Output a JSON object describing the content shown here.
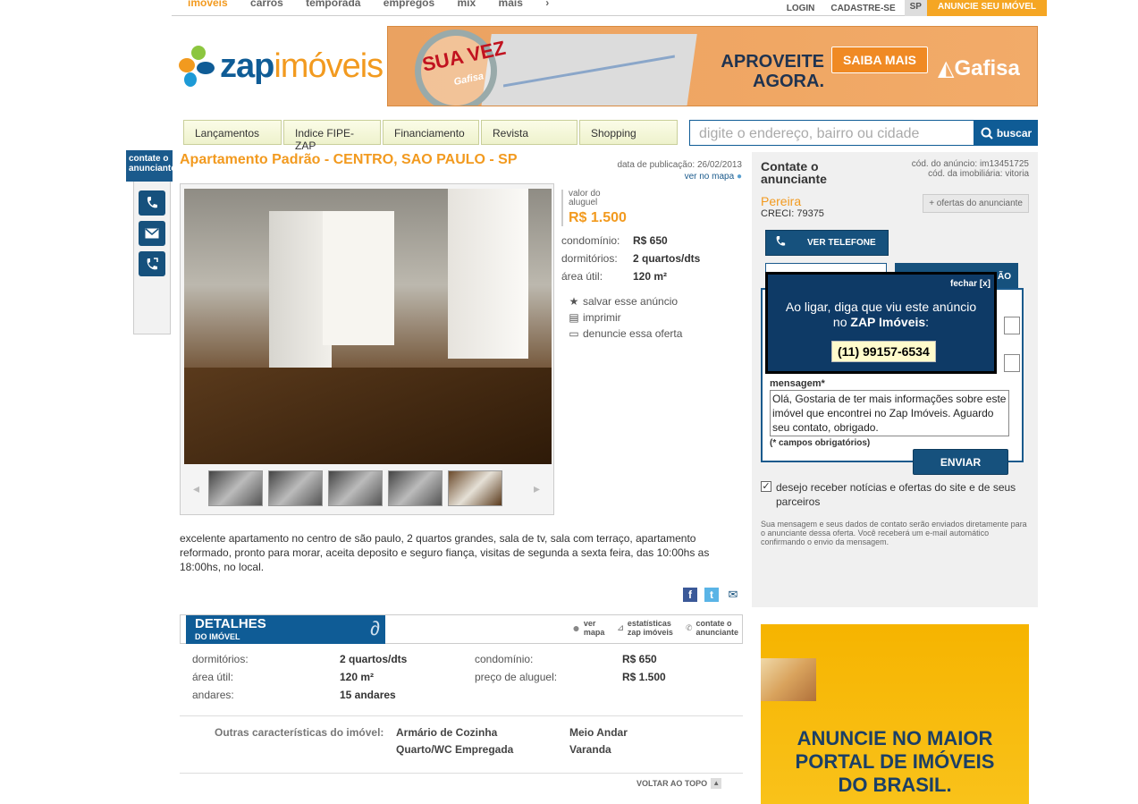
{
  "topnav": {
    "links": [
      "imóveis",
      "carros",
      "temporada",
      "empregos",
      "mix",
      "mais"
    ],
    "login": "LOGIN",
    "cadastre": "CADASTRE-SE",
    "region": "SP",
    "anuncie": "ANUNCIE SEU IMÓVEL"
  },
  "logo": {
    "zap": "zap",
    "imoveis": "imóveis"
  },
  "banner": {
    "sua_vez": "SUA VEZ",
    "brand_small": "Gafisa",
    "aproveite": "APROVEITE AGORA.",
    "saiba": "SAIBA MAIS",
    "brand": "Gafisa"
  },
  "tabs": [
    "Lançamentos",
    "Indice FIPE-ZAP",
    "Financiamento",
    "Revista",
    "Shopping"
  ],
  "search": {
    "placeholder": "digite o endereço, bairro ou cidade",
    "button": "buscar"
  },
  "side": {
    "label": "contate o anunciante"
  },
  "listing": {
    "title": "Apartamento Padrão - CENTRO, SAO PAULO - SP",
    "pubdate": "data de publicação: 26/02/2013",
    "map_link": "ver no mapa",
    "price_label": "valor do aluguel",
    "price": "R$ 1.500",
    "specs": [
      {
        "k": "condomínio:",
        "v": "R$ 650"
      },
      {
        "k": "dormitórios:",
        "v": "2 quartos/dts"
      },
      {
        "k": "área útil:",
        "v": "120 m²"
      }
    ],
    "actions": [
      "salvar esse anúncio",
      "imprimir",
      "denuncie essa oferta"
    ],
    "description": "excelente apartamento no centro de são paulo, 2 quartos grandes, sala de tv, sala com terraço, apartamento reformado, pronto para morar, aceita deposito e seguro fiança, visitas de segunda a sexta feira, das 10:00hs as 18:00hs, no local."
  },
  "details": {
    "title": "DETALHES",
    "subtitle": "DO IMÓVEL",
    "links": [
      {
        "a": "ver",
        "b": "mapa"
      },
      {
        "a": "estatísticas",
        "b": "zap imóveis"
      },
      {
        "a": "contate o",
        "b": "anunciante"
      }
    ],
    "rows": [
      {
        "k": "dormitórios:",
        "v": "2 quartos/dts",
        "k2": "condomínio:",
        "v2": "R$ 650"
      },
      {
        "k": "área útil:",
        "v": "120 m²",
        "k2": "preço de aluguel:",
        "v2": "R$ 1.500"
      },
      {
        "k": "andares:",
        "v": "15 andares",
        "k2": "",
        "v2": ""
      }
    ],
    "outras_label": "Outras características do imóvel:",
    "features": [
      "Armário de Cozinha",
      "Meio Andar",
      "Quarto/WC Empregada",
      "Varanda"
    ],
    "voltar": "VOLTAR AO TOPO"
  },
  "contact": {
    "title": "Contate o anunciante",
    "cod_anuncio": "cód. do anúncio: im13451725",
    "cod_imob": "cód. da imobiliária: vitoria",
    "name": "Pereira",
    "creci": "CRECI: 79375",
    "ofertas": "+ ofertas do anunciante",
    "ver_telefone": "VER TELEFONE",
    "behind_btn": "ÃO",
    "mensagem_label": "mensagem*",
    "mensagem": "Olá, Gostaria de ter mais informações sobre este imóvel que encontrei no Zap Imóveis. Aguardo seu contato, obrigado.",
    "required": "(* campos obrigatórios)",
    "enviar": "ENVIAR",
    "checkbox": "desejo receber notícias e ofertas do site e de seus parceiros",
    "note": "Sua mensagem e seus dados de contato serão enviados diretamente para o anunciante dessa oferta. Você receberá um e-mail automático confirmando o envio da mensagem."
  },
  "popup": {
    "fechar": "fechar [x]",
    "msg_line1": "Ao ligar, diga que viu este anúncio",
    "msg_line2_pre": "no",
    "msg_line2_brand": "ZAP Imóveis",
    "phone": "(11) 99157-6534"
  },
  "ad2": {
    "text": "ANUNCIE NO MAIOR PORTAL DE IMÓVEIS DO BRASIL."
  },
  "colors": {
    "orange": "#f29a1f",
    "blue": "#0f5c96",
    "navy": "#0e3a66"
  }
}
